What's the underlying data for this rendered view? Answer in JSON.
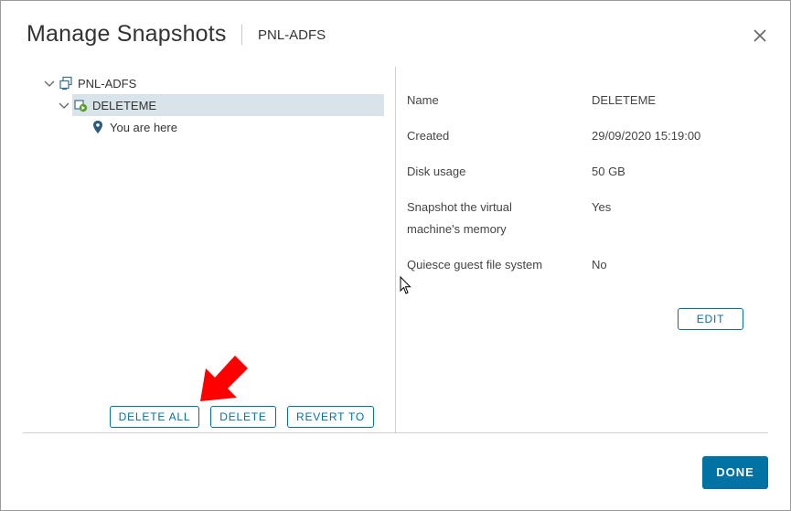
{
  "dialog": {
    "title": "Manage Snapshots",
    "subtitle": "PNL-ADFS"
  },
  "tree": {
    "root_label": "PNL-ADFS",
    "snapshot_label": "DELETEME",
    "current_label": "You are here"
  },
  "details": {
    "name_label": "Name",
    "name_value": "DELETEME",
    "created_label": "Created",
    "created_value": "29/09/2020 15:19:00",
    "disk_label": "Disk usage",
    "disk_value": "50 GB",
    "memory_label_line1": "Snapshot the virtual",
    "memory_label_line2": "machine's memory",
    "memory_value": "Yes",
    "quiesce_label": "Quiesce guest file system",
    "quiesce_value": "No",
    "edit_label": "EDIT"
  },
  "actions": {
    "delete_all_label": "DELETE ALL",
    "delete_label": "DELETE",
    "revert_label": "REVERT TO",
    "done_label": "DONE"
  },
  "colors": {
    "accent": "#0072a3",
    "selected_row": "#d9e4ea",
    "annotation_arrow": "#ff0000"
  }
}
